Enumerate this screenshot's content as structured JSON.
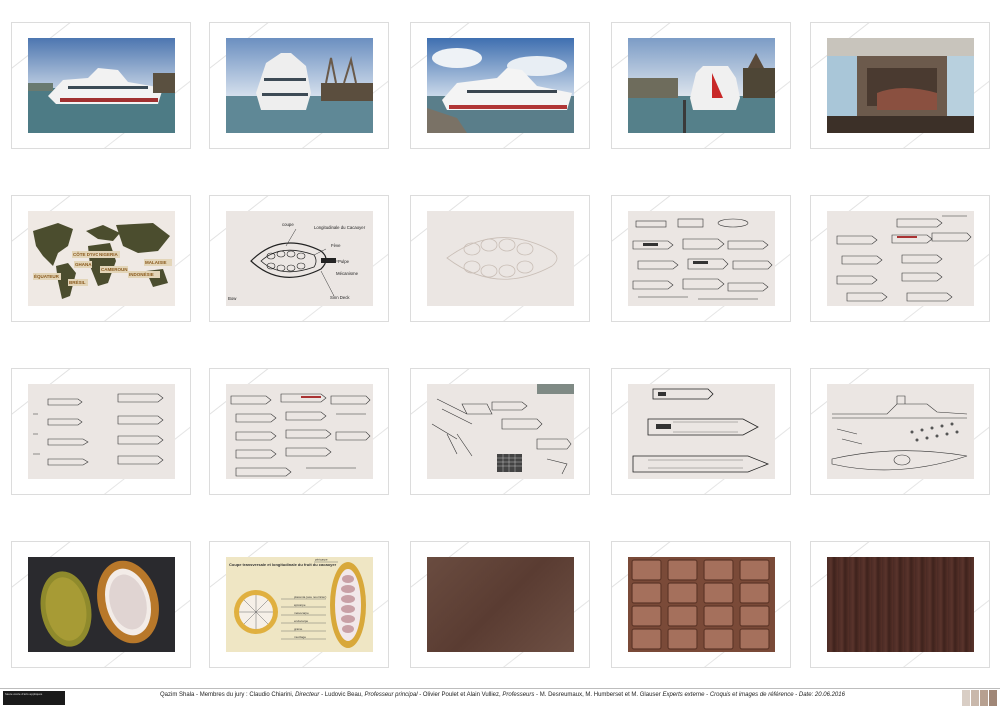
{
  "sheet": {
    "footer": {
      "logo_text": "haute école d'arts appliqués",
      "author": "Qazim Shala",
      "jury_label": "Membres du jury :",
      "jury": [
        {
          "name": "Claudio Chiarini",
          "role": "Directeur"
        },
        {
          "name": "Ludovic Beau",
          "role": "Professeur principal"
        },
        {
          "name": "Olivier Poulet et Alain Vulliez",
          "role": "Professeurs"
        },
        {
          "name": "M. Desreumaux, M. Humberset et M. Glauser",
          "role": "Experts externe"
        }
      ],
      "subject": "Croquis et images de référence",
      "date_label": "Date:",
      "date": "20.06.2016",
      "swatch_colors": [
        "#d9cec5",
        "#c9b8ab",
        "#b7a090",
        "#a08777"
      ]
    },
    "panels": [
      {
        "id": "boat-1",
        "kind": "photo"
      },
      {
        "id": "boat-2",
        "kind": "photo"
      },
      {
        "id": "boat-3",
        "kind": "photo"
      },
      {
        "id": "boat-4",
        "kind": "photo"
      },
      {
        "id": "interior",
        "kind": "photo"
      },
      {
        "id": "world-map",
        "kind": "map",
        "labels": [
          "CÔTE D'IVOIRE",
          "GHANA",
          "NIGERIA",
          "CAMEROUN",
          "ÉQUATEUR",
          "BRÉSIL",
          "INDONÉSIE",
          "MALAISIE"
        ]
      },
      {
        "id": "cocoa-sketch",
        "kind": "sketch",
        "labels": [
          "coupe",
          "Longitudinale du Cacaoyer",
          "Fève",
          "Pulpe",
          "Sinn Deck",
          "Mécanisme",
          "Bow"
        ]
      },
      {
        "id": "cocoa-outline",
        "kind": "sketch"
      },
      {
        "id": "sketch-ships-1",
        "kind": "sketch"
      },
      {
        "id": "sketch-ships-2",
        "kind": "sketch"
      },
      {
        "id": "sketch-ships-3",
        "kind": "sketch"
      },
      {
        "id": "sketch-ships-4",
        "kind": "sketch"
      },
      {
        "id": "sketch-perspective",
        "kind": "sketch"
      },
      {
        "id": "sketch-plans",
        "kind": "sketch"
      },
      {
        "id": "sketch-elevation",
        "kind": "sketch"
      },
      {
        "id": "cocoa-photo",
        "kind": "photo"
      },
      {
        "id": "cocoa-diagram",
        "kind": "diagram",
        "title": "Coupe transversale et longitudinale du fruit du cacaoyer",
        "labels": [
          "péricarpe",
          "placenta (axe nourricier)",
          "épicarpe",
          "mésocarpe",
          "endocarpe",
          "graine",
          "mucilage"
        ]
      },
      {
        "id": "texture-brown",
        "kind": "texture"
      },
      {
        "id": "texture-chocolate",
        "kind": "texture"
      },
      {
        "id": "texture-wood",
        "kind": "texture"
      }
    ]
  }
}
